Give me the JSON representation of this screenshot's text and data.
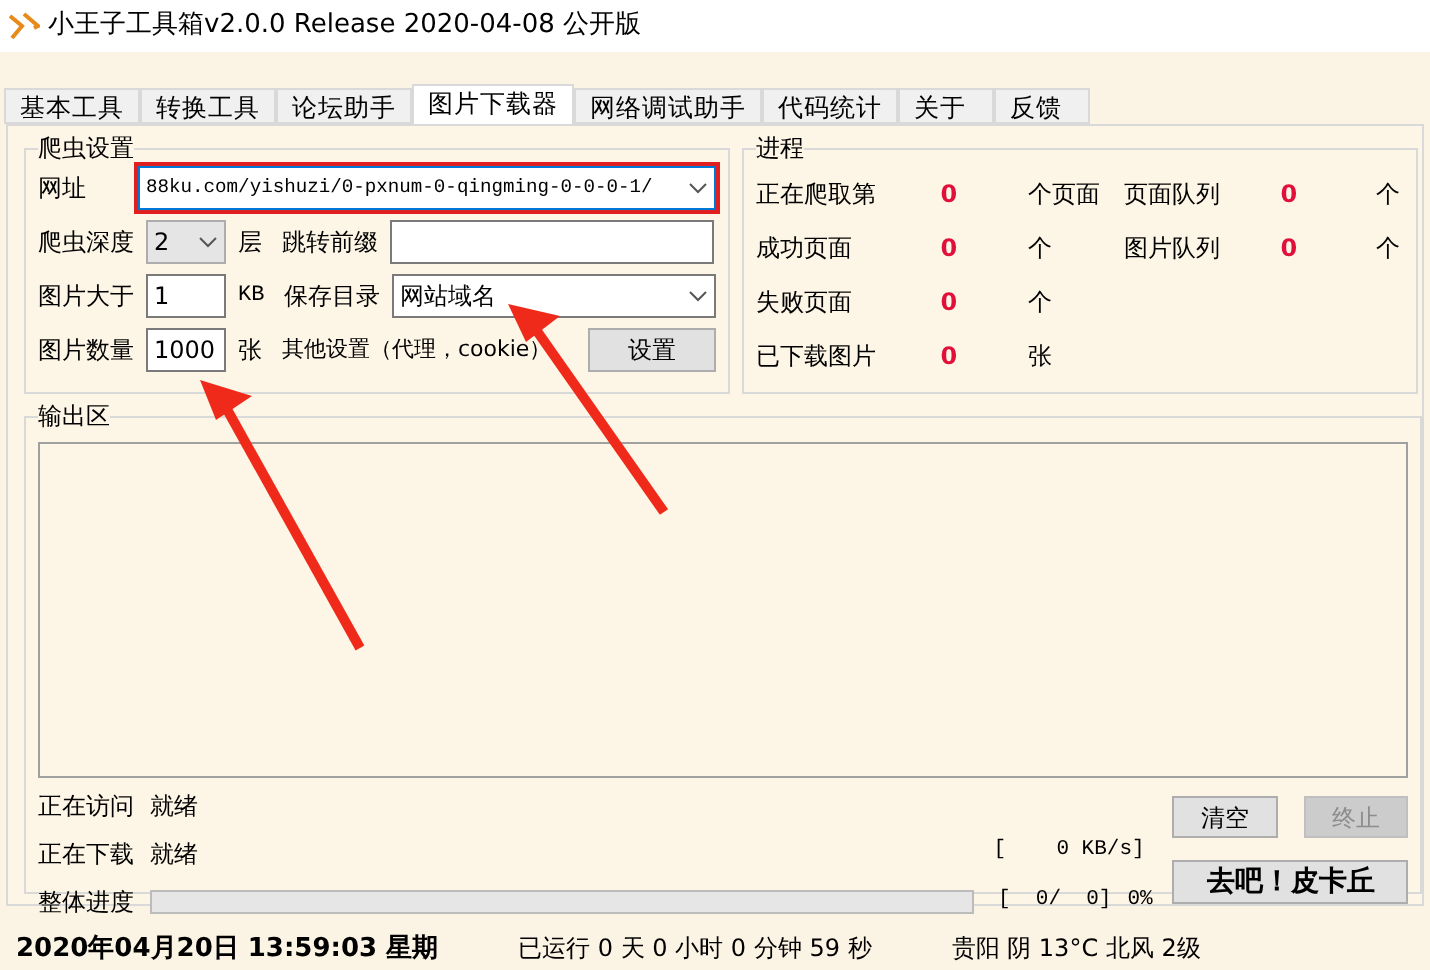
{
  "window": {
    "title": "小王子工具箱v2.0.0 Release 2020-04-08 公开版"
  },
  "tabs": [
    {
      "label": "基本工具",
      "selected": false
    },
    {
      "label": "转换工具",
      "selected": false
    },
    {
      "label": "论坛助手",
      "selected": false
    },
    {
      "label": "图片下载器",
      "selected": true
    },
    {
      "label": "网络调试助手",
      "selected": false
    },
    {
      "label": "代码统计",
      "selected": false
    },
    {
      "label": "关于",
      "selected": false
    },
    {
      "label": "反馈",
      "selected": false
    }
  ],
  "crawler_settings": {
    "title": "爬虫设置",
    "url_label": "网址",
    "url_value": "88ku.com/yishuzi/0-pxnum-0-qingming-0-0-0-1/",
    "url_highlighted": true,
    "depth_label": "爬虫深度",
    "depth_value": "2",
    "depth_unit": "层",
    "jump_prefix_label": "跳转前缀",
    "size_label": "图片大于",
    "size_value": "1",
    "size_unit": "KB",
    "save_dir_label": "保存目录",
    "save_dir_value": "网站域名",
    "count_label": "图片数量",
    "count_value": "1000",
    "count_unit": "张",
    "other_label": "其他设置（代理，cookie）",
    "settings_button": "设置"
  },
  "progress": {
    "title": "进程",
    "items": [
      {
        "label": "正在爬取第",
        "value": "0",
        "unit": "个页面"
      },
      {
        "label": "页面队列",
        "value": "0",
        "unit": "个"
      },
      {
        "label": "成功页面",
        "value": "0",
        "unit": "个"
      },
      {
        "label": "图片队列",
        "value": "0",
        "unit": "个"
      },
      {
        "label": "失败页面",
        "value": "0",
        "unit": "个"
      },
      {
        "label": "已下载图片",
        "value": "0",
        "unit": "张"
      }
    ]
  },
  "output": {
    "title": "输出区"
  },
  "status": {
    "visiting_label": "正在访问",
    "visiting_value": "就绪",
    "downloading_label": "正在下载",
    "downloading_value": "就绪",
    "speed": "[    0 KB/s]",
    "overall_label": "整体进度",
    "level": 0,
    "counter": "[  0/  0]",
    "percent": "0%"
  },
  "buttons": [
    {
      "label": "清空",
      "disabled": false,
      "bold": false
    },
    {
      "label": "终止",
      "disabled": true,
      "bold": false
    },
    {
      "label": "去吧！皮卡丘",
      "disabled": false,
      "bold": true
    }
  ],
  "status_bar": [
    "2020年04月20日 13:59:03 星期",
    "已运行 0 天 0 小时 0 分钟 59 秒",
    "贵阳 阴 13°C 北风 2级"
  ]
}
